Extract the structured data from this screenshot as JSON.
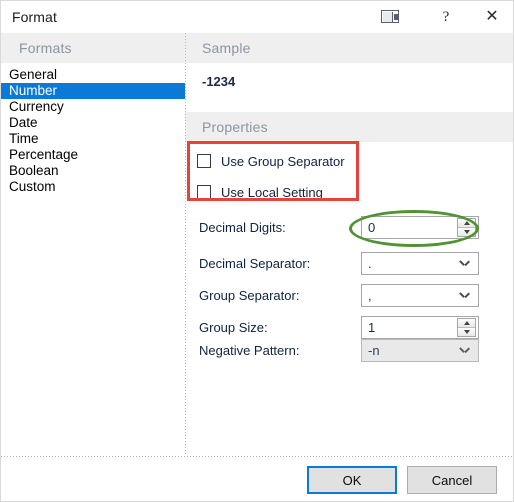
{
  "window": {
    "title": "Format",
    "icons": {
      "window_mode": "window-mode-icon",
      "help": "?",
      "close": "✕"
    }
  },
  "sections": {
    "formats_header": "Formats",
    "sample_header": "Sample",
    "properties_header": "Properties"
  },
  "formats_list": {
    "selected": "Number",
    "items": [
      {
        "label": "General"
      },
      {
        "label": "Number"
      },
      {
        "label": "Currency"
      },
      {
        "label": "Date"
      },
      {
        "label": "Time"
      },
      {
        "label": "Percentage"
      },
      {
        "label": "Boolean"
      },
      {
        "label": "Custom"
      }
    ]
  },
  "sample": {
    "value": "-1234"
  },
  "properties": {
    "checkboxes": [
      {
        "label": "Use Group Separator",
        "checked": false
      },
      {
        "label": "Use Local Setting",
        "checked": false
      }
    ],
    "fields": [
      {
        "label": "Decimal Digits:",
        "value": "0",
        "control": "spinner",
        "disabled": false
      },
      {
        "label": "Decimal Separator:",
        "value": ".",
        "control": "combo",
        "disabled": false
      },
      {
        "label": "Group Separator:",
        "value": ",",
        "control": "combo",
        "disabled": false
      },
      {
        "label": "Group Size:",
        "value": "1",
        "control": "spinner",
        "disabled": false
      },
      {
        "label": "Negative Pattern:",
        "value": "-n",
        "control": "combo",
        "disabled": true
      }
    ]
  },
  "annotations": {
    "rectangle_color": "#e8433a",
    "ellipse_color": "#4e9433"
  },
  "footer": {
    "ok_label": "OK",
    "cancel_label": "Cancel"
  },
  "colors": {
    "accent": "#0b7ad6",
    "band_bg": "#efefef",
    "band_text": "#8d94a3"
  }
}
